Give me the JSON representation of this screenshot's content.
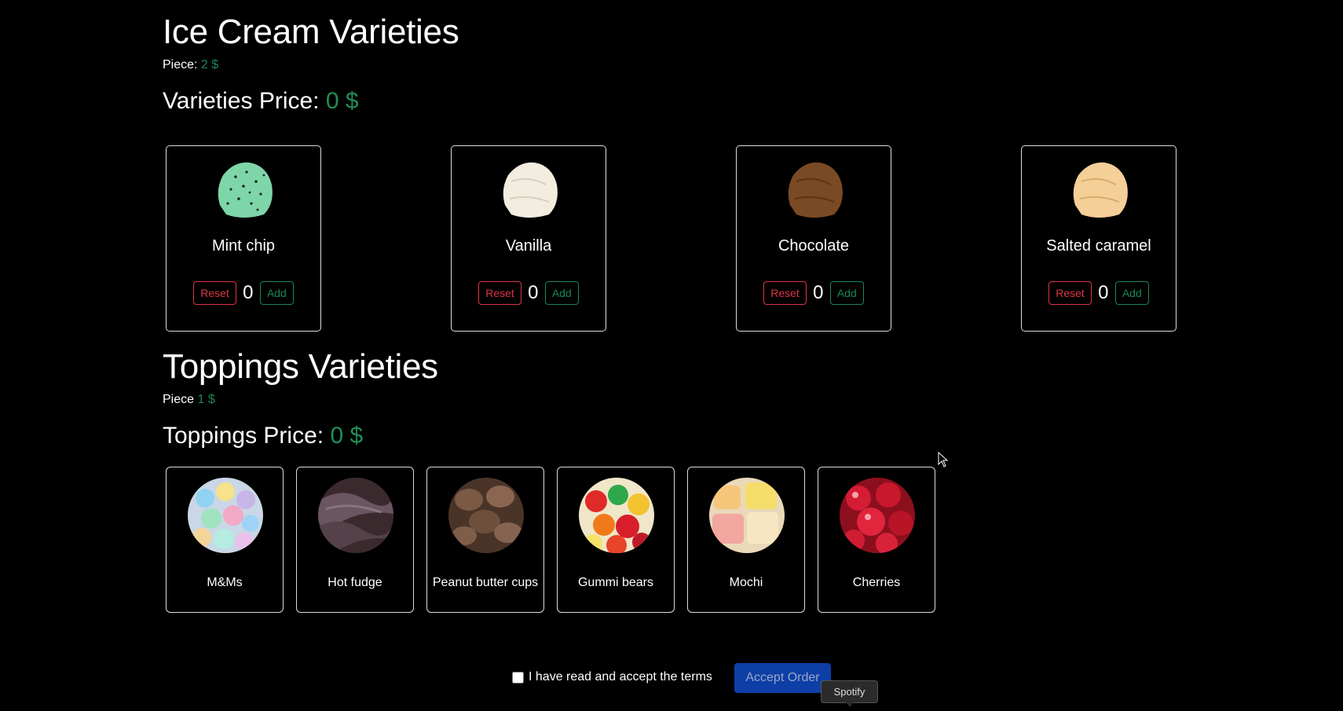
{
  "ice_cream": {
    "title": "Ice Cream Varieties",
    "piece_label": "Piece:",
    "piece_price": "2 $",
    "price_label": "Varieties Price:",
    "price_value": "0 $",
    "reset_label": "Reset",
    "add_label": "Add",
    "items": [
      {
        "name": "Mint chip",
        "count": "0",
        "color": "#7ed6a8"
      },
      {
        "name": "Vanilla",
        "count": "0",
        "color": "#f3ede0"
      },
      {
        "name": "Chocolate",
        "count": "0",
        "color": "#7a4a24"
      },
      {
        "name": "Salted caramel",
        "count": "0",
        "color": "#f4cf98"
      }
    ]
  },
  "toppings": {
    "title": "Toppings Varieties",
    "piece_label": "Piece",
    "piece_price": "1 $",
    "price_label": "Toppings Price:",
    "price_value": "0 $",
    "items": [
      {
        "name": "M&Ms"
      },
      {
        "name": "Hot fudge"
      },
      {
        "name": "Peanut butter cups"
      },
      {
        "name": "Gummi bears"
      },
      {
        "name": "Mochi"
      },
      {
        "name": "Cherries"
      }
    ]
  },
  "footer": {
    "terms_label": "I have read and accept the terms",
    "accept_label": "Accept Order",
    "tooltip": "Spotify"
  },
  "colors": {
    "accent_green": "#198754",
    "reset_red": "#dc3545",
    "accept_blue": "#0d3fa6"
  }
}
